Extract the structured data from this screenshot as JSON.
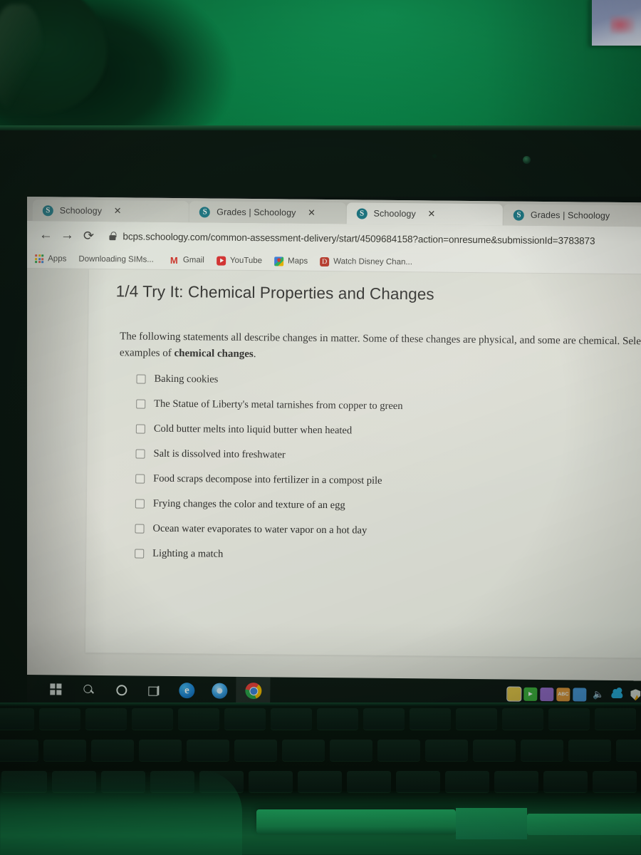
{
  "browser": {
    "tabs": [
      {
        "title": "Schoology",
        "favicon": "schoology-icon",
        "active": false
      },
      {
        "title": "Grades | Schoology",
        "favicon": "schoology-icon",
        "active": false
      },
      {
        "title": "Schoology",
        "favicon": "schoology-icon",
        "active": true
      },
      {
        "title": "Grades | Schoology",
        "favicon": "schoology-icon",
        "active": false
      }
    ],
    "close_label": "✕",
    "nav": {
      "back": "←",
      "forward": "→",
      "reload": "⟳"
    },
    "omnibox": {
      "url": "bcps.schoology.com/common-assessment-delivery/start/4509684158?action=onresume&submissionId=3783873",
      "lock_icon": "lock-icon"
    },
    "bookmarks": [
      {
        "label": "Apps",
        "icon": "apps-grid-icon"
      },
      {
        "label": "Downloading SIMs...",
        "icon": "none"
      },
      {
        "label": "Gmail",
        "icon": "gmail-icon"
      },
      {
        "label": "YouTube",
        "icon": "youtube-icon"
      },
      {
        "label": "Maps",
        "icon": "maps-icon"
      },
      {
        "label": "Watch Disney Chan...",
        "icon": "disney-icon"
      }
    ]
  },
  "assessment": {
    "title": "1/4 Try It: Chemical Properties and Changes",
    "prompt_part1": "The following statements all describe changes in matter. Some of these changes are physical, and some are chemical. Select the examples of ",
    "prompt_bold": "chemical changes",
    "prompt_end": ".",
    "options": [
      {
        "label": "Baking cookies",
        "checked": false
      },
      {
        "label": "The Statue of Liberty's metal tarnishes from copper to green",
        "checked": false
      },
      {
        "label": "Cold butter melts into liquid butter when heated",
        "checked": false
      },
      {
        "label": "Salt is dissolved into freshwater",
        "checked": false
      },
      {
        "label": "Food scraps decompose into fertilizer in a compost pile",
        "checked": false
      },
      {
        "label": "Frying changes the color and texture of an egg",
        "checked": false
      },
      {
        "label": "Ocean water evaporates to water vapor on a hot day",
        "checked": false
      },
      {
        "label": "Lighting a match",
        "checked": false
      }
    ]
  },
  "taskbar": {
    "items": [
      {
        "name": "start-button",
        "icon": "windows-logo-icon"
      },
      {
        "name": "search-button",
        "icon": "search-icon"
      },
      {
        "name": "cortana-button",
        "icon": "cortana-circle-icon"
      },
      {
        "name": "task-view-button",
        "icon": "task-view-icon"
      },
      {
        "name": "edge-button",
        "icon": "edge-icon",
        "glyph": "e"
      },
      {
        "name": "chromium-button",
        "icon": "chromium-icon"
      },
      {
        "name": "chrome-button",
        "icon": "chrome-icon",
        "active": true
      }
    ],
    "tray": [
      {
        "name": "tray-app-yellow",
        "icon": "image-app-icon",
        "color": "#e8c64a",
        "glyph": ""
      },
      {
        "name": "tray-app-green",
        "icon": "play-app-icon",
        "color": "#3fb53f",
        "glyph": "▶"
      },
      {
        "name": "tray-app-purple",
        "icon": "note-app-icon",
        "color": "#9a6fd0",
        "glyph": ""
      },
      {
        "name": "tray-app-orange",
        "icon": "abc-app-icon",
        "color": "#e89b3c",
        "glyph": "ABC"
      },
      {
        "name": "tray-app-blue",
        "icon": "photo-app-icon",
        "color": "#4a9ce0",
        "glyph": ""
      },
      {
        "name": "volume-icon",
        "icon": "volume-icon",
        "glyph": "🔊"
      },
      {
        "name": "onedrive-icon",
        "icon": "cloud-icon"
      },
      {
        "name": "security-icon",
        "icon": "shield-warning-icon"
      }
    ]
  },
  "colors": {
    "wall_green": "#0b8448",
    "tab_bar": "#cfccc6",
    "toolbar": "#efece7",
    "page_bg": "#dedbd4",
    "card_bg": "#e6e3dc",
    "taskbar": "#0e1b14",
    "chrome_accent": "#6fb8e8"
  }
}
